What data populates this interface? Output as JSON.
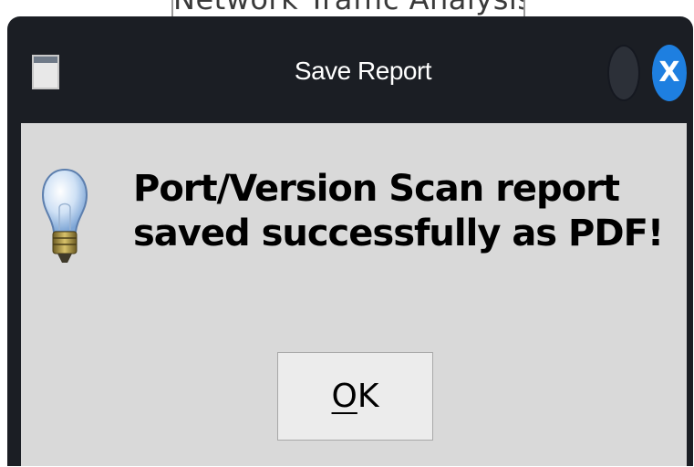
{
  "background_window": {
    "title": "Network Traffic Analysis"
  },
  "dialog": {
    "title": "Save Report",
    "window_icon": "window-icon",
    "close_label": "X",
    "message_icon": "lightbulb-icon",
    "message": "Port/Version Scan report saved successfully as PDF!",
    "ok_mnemonic": "O",
    "ok_rest": "K"
  },
  "colors": {
    "titlebar": "#1b1e24",
    "content": "#d9d9d9",
    "close_button": "#1e7fe0",
    "button_face": "#ececec"
  }
}
